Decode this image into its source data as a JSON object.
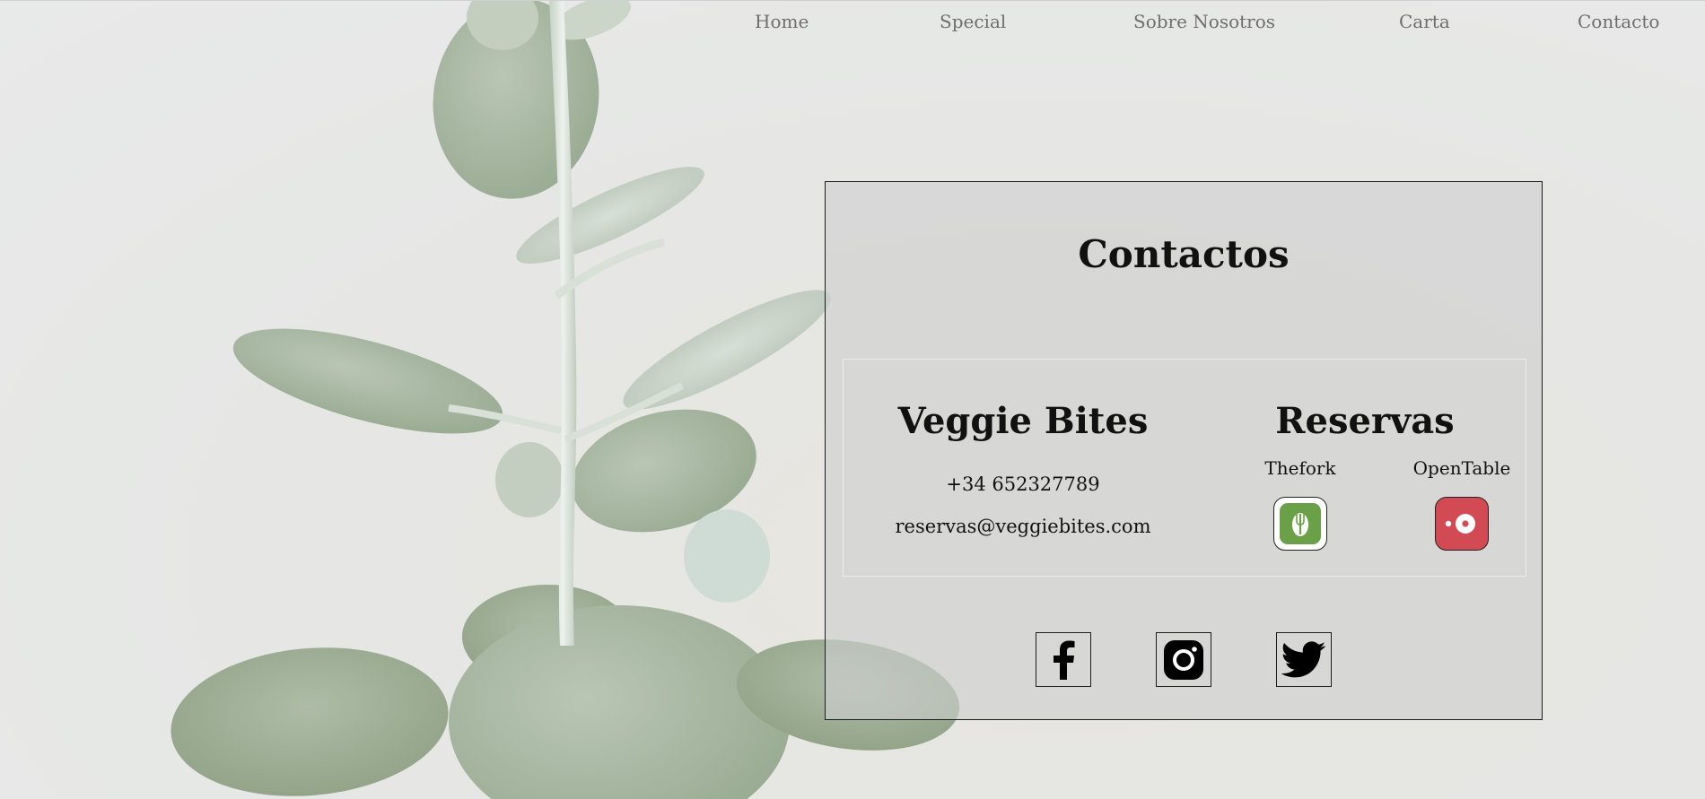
{
  "nav": {
    "items": [
      "Home",
      "Special",
      "Sobre Nosotros",
      "Carta",
      "Contacto"
    ]
  },
  "contact": {
    "title": "Contactos",
    "restaurant": {
      "name": "Veggie Bites",
      "phone": "+34 652327789",
      "email": "reservas@veggiebites.com"
    },
    "reservations": {
      "title": "Reservas",
      "services": [
        {
          "label": "Thefork",
          "icon": "thefork-icon",
          "color": "#6aa047"
        },
        {
          "label": "OpenTable",
          "icon": "opentable-icon",
          "color": "#d24b54"
        }
      ]
    },
    "social": [
      {
        "icon": "facebook-icon"
      },
      {
        "icon": "instagram-icon"
      },
      {
        "icon": "twitter-icon"
      }
    ]
  },
  "colors": {
    "background": "#e6e7e6",
    "panel_border": "#1d1d1d",
    "nav_text": "#6e6e6e",
    "leaf": "#a7b7a0"
  }
}
